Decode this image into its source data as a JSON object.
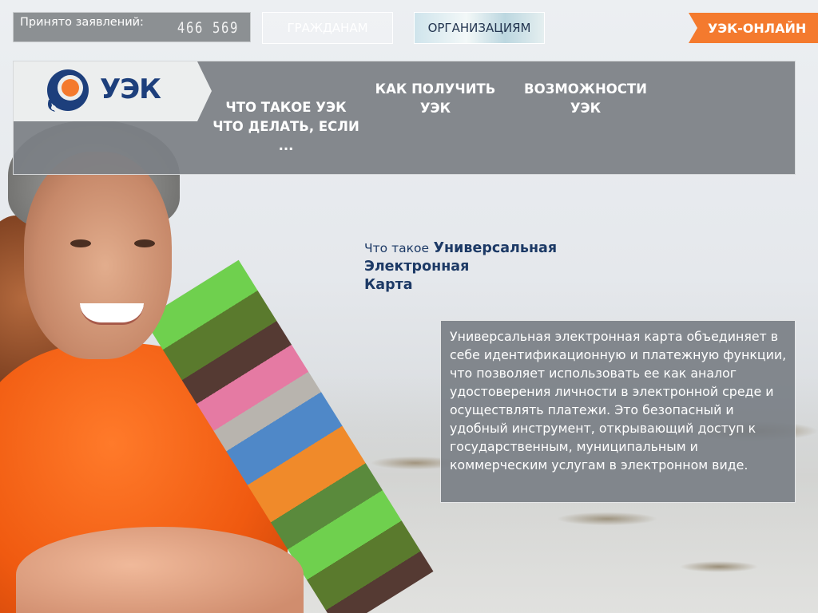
{
  "topbar": {
    "counter_label": "Принято заявлений:",
    "counter_value": "466 569",
    "citizens_label": "ГРАЖДАНАМ",
    "organizations_label": "ОРГАНИЗАЦИЯМ",
    "online_label": "УЭК-ОНЛАЙН"
  },
  "header": {
    "logo_text": "УЭК",
    "nav": [
      {
        "label_line1": "ЧТО ТАКОЕ УЭК",
        "label_line2": "ЧТО ДЕЛАТЬ, ЕСЛИ",
        "label_line3": "..."
      },
      {
        "label_line1": "КАК ПОЛУЧИТЬ",
        "label_line2": "УЭК"
      },
      {
        "label_line1": "ВОЗМОЖНОСТИ",
        "label_line2": "УЭК"
      }
    ]
  },
  "main": {
    "title_prefix": "Что такое",
    "title_line1": "Универсальная",
    "title_line2": "Электронная",
    "title_line3": "Карта",
    "description": "Универсальная электронная карта объединяет в себе идентификационную и платежную функции, что позволяет использовать ее как аналог удостоверения личности в электронной среде и осуществлять платежи. Это безопасный и удобный инструмент, открывающий доступ к государственным, муниципальным и коммерческим услугам в электронном виде."
  },
  "colors": {
    "accent_orange": "#f47a2e",
    "brand_blue": "#1d3f7c",
    "header_gray": "#7c8085"
  },
  "icons": {
    "logo": "uek-logo-icon"
  }
}
